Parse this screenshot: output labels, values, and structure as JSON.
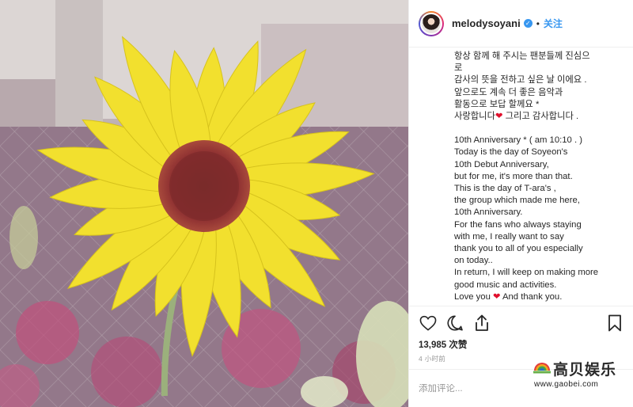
{
  "post": {
    "username": "melodysoyani",
    "verified_icon": "verified-badge-icon",
    "follow_label": "关注",
    "separator": "•"
  },
  "caption_lines": [
    "항상 함께 해 주시는 팬분들께 진심으",
    "로",
    "감사의 뜻을 전하고 싶은 날 이에요 .",
    "앞으로도 계속 더 좋은 음악과",
    "활동으로 보답 할께요 *",
    "사랑합니다",
    " 그리고 감사합니다 .",
    "",
    "10th Anniversary * ( am 10:10 . )",
    "Today is the day of Soyeon's",
    "10th Debut Anniversary,",
    "but for me, it's more than that.",
    "This is the day of T-ara's ,",
    " the group which made me here,",
    "10th Anniversary.",
    "For the fans who always staying",
    "with me, I really want to say",
    "thank you to all of you especially",
    "on today..",
    "In return, I will keep on making more",
    "good music and activities.",
    "Love you",
    " And thank you."
  ],
  "likes": {
    "count": "13,985",
    "label": "次赞"
  },
  "time_ago": "4 小时前",
  "comment": {
    "placeholder": "添加评论..."
  },
  "watermark": {
    "title": "高贝娱乐",
    "url": "www.gaobei.com"
  },
  "colors": {
    "accent": "#3897f0",
    "heart": "#e0102d",
    "petal": "#f2e02e",
    "flower_center": "#8a2a2a"
  }
}
